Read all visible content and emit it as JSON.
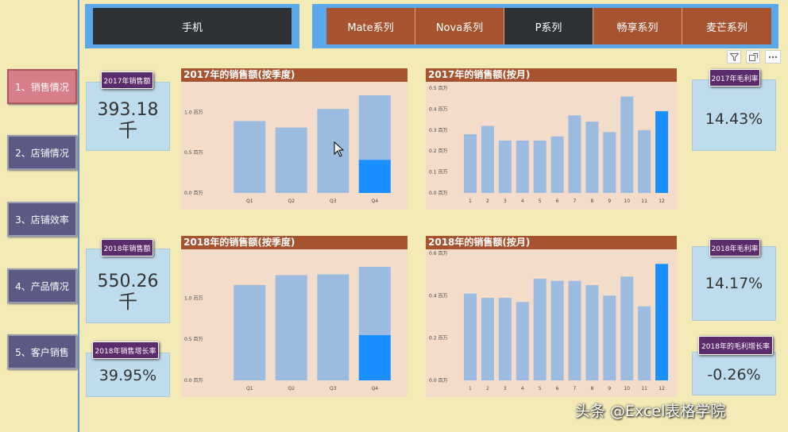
{
  "nav": {
    "items": [
      {
        "label": "1、销售情况"
      },
      {
        "label": "2、店铺情况"
      },
      {
        "label": "3、店铺效率"
      },
      {
        "label": "4、产品情况"
      },
      {
        "label": "5、客户销售"
      }
    ]
  },
  "category_slicer": {
    "label": "手机"
  },
  "series_slicer": {
    "items": [
      {
        "label": "Mate系列",
        "selected": false
      },
      {
        "label": "Nova系列",
        "selected": false
      },
      {
        "label": "P系列",
        "selected": true
      },
      {
        "label": "畅享系列",
        "selected": false
      },
      {
        "label": "麦芒系列",
        "selected": false
      }
    ]
  },
  "cards": {
    "sales_2017": {
      "title": "2017年销售额",
      "value": "393.18",
      "unit": "千"
    },
    "sales_2018": {
      "title": "2018年销售额",
      "value": "550.26",
      "unit": "千"
    },
    "growth_2018": {
      "title": "2018年销售增长率",
      "value": "39.95%"
    },
    "margin_2017": {
      "title": "2017年毛利率",
      "value": "14.43%"
    },
    "margin_2018": {
      "title": "2018年毛利率",
      "value": "14.17%"
    },
    "margin_growth_2018": {
      "title": "2018年的毛利增长率",
      "value": "-0.26%"
    }
  },
  "toolbar_icons": [
    "filter-icon",
    "focus-mode-icon",
    "more-options-icon"
  ],
  "watermark": "头条 @Excel表格学院",
  "colors": {
    "bar": "#9bbbe0",
    "highlight": "#1a8fff",
    "title_bar": "#a8532f"
  },
  "chart_data": [
    {
      "type": "bar",
      "title": "2017年的销售额(按季度)",
      "categories": [
        "Q1",
        "Q2",
        "Q3",
        "Q4"
      ],
      "y_ticks": [
        "0.0 百万",
        "0.5 百万",
        "1.0 百万"
      ],
      "ylim": [
        0,
        1.2
      ],
      "series": [
        {
          "values": [
            0.89,
            0.81,
            1.04,
            1.21
          ]
        },
        {
          "values": [
            0,
            0,
            0,
            0.41
          ]
        }
      ]
    },
    {
      "type": "bar",
      "title": "2017年的销售额(按月)",
      "categories": [
        "1",
        "2",
        "3",
        "4",
        "5",
        "6",
        "7",
        "8",
        "9",
        "10",
        "11",
        "12"
      ],
      "y_ticks": [
        "0.0 百万",
        "0.1 百万",
        "0.2 百万",
        "0.3 百万",
        "0.4 百万",
        "0.5 百万"
      ],
      "ylim": [
        0,
        0.5
      ],
      "highlight_index": 11,
      "series": [
        {
          "values": [
            0.28,
            0.32,
            0.25,
            0.25,
            0.25,
            0.27,
            0.37,
            0.34,
            0.29,
            0.46,
            0.3,
            0.39
          ]
        }
      ]
    },
    {
      "type": "bar",
      "title": "2018年的销售额(按季度)",
      "categories": [
        "Q1",
        "Q2",
        "Q3",
        "Q4"
      ],
      "y_ticks": [
        "0.0 百万",
        "0.5 百万",
        "1.0 百万"
      ],
      "ylim": [
        0,
        1.4
      ],
      "series": [
        {
          "values": [
            1.16,
            1.28,
            1.29,
            1.38
          ]
        },
        {
          "values": [
            0,
            0,
            0,
            0.55
          ]
        }
      ]
    },
    {
      "type": "bar",
      "title": "2018年的销售额(按月)",
      "categories": [
        "1",
        "2",
        "3",
        "4",
        "5",
        "6",
        "7",
        "8",
        "9",
        "10",
        "11",
        "12"
      ],
      "y_ticks": [
        "0.0 百万",
        "0.2 百万",
        "0.4 百万",
        "0.6 百万"
      ],
      "ylim": [
        0,
        0.6
      ],
      "highlight_index": 11,
      "series": [
        {
          "values": [
            0.41,
            0.39,
            0.39,
            0.37,
            0.48,
            0.47,
            0.47,
            0.45,
            0.4,
            0.49,
            0.35,
            0.55
          ]
        }
      ]
    }
  ]
}
